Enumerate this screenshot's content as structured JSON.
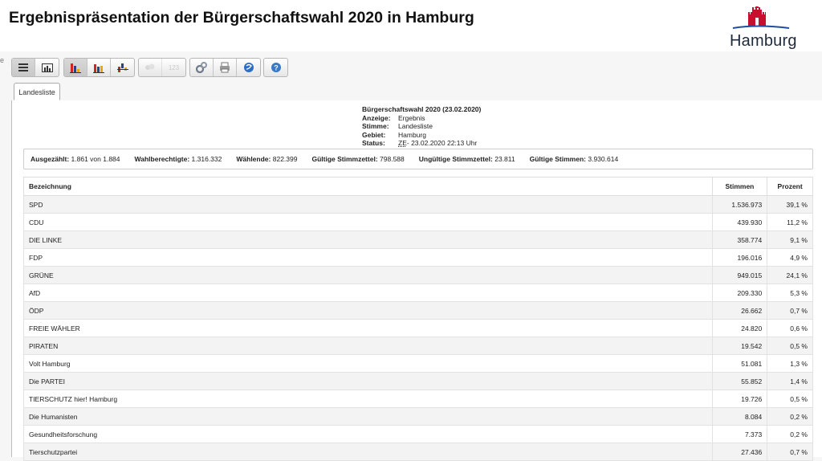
{
  "page": {
    "title": "Ergebnispräsentation der Bürgerschaftswahl 2020 in Hamburg",
    "logo_text": "Hamburg",
    "side_mark": "e"
  },
  "toolbar": {
    "buttons": [
      {
        "name": "table-view-button",
        "icon": "table-icon",
        "active": true
      },
      {
        "name": "chart-view-button",
        "icon": "chart-icon",
        "active": false
      },
      {
        "name": "bar-chart-button",
        "icon": "bar-chart-icon",
        "active": true
      },
      {
        "name": "stacked-chart-button",
        "icon": "stacked-bar-icon",
        "active": false
      },
      {
        "name": "comparison-chart-button",
        "icon": "comparison-chart-icon",
        "active": false
      },
      {
        "name": "seats-button",
        "icon": "seats-icon",
        "disabled": true
      },
      {
        "name": "number-button",
        "label": "123",
        "disabled": true
      },
      {
        "name": "settings-button",
        "icon": "gears-icon"
      },
      {
        "name": "print-button",
        "icon": "printer-icon"
      },
      {
        "name": "share-button",
        "icon": "globe-icon"
      },
      {
        "name": "help-button",
        "icon": "help-icon"
      }
    ]
  },
  "tabs": [
    {
      "label": "Landesliste",
      "active": true
    }
  ],
  "meta": {
    "title": "Bürgerschaftswahl 2020 (23.02.2020)",
    "rows": [
      {
        "key": "Anzeige:",
        "value": "Ergebnis"
      },
      {
        "key": "Stimme:",
        "value": "Landesliste"
      },
      {
        "key": "Gebiet:",
        "value": "Hamburg"
      },
      {
        "key": "Status:",
        "value_prefix": "ZE",
        "value": " - 23.02.2020 22:13 Uhr"
      }
    ]
  },
  "stats": [
    {
      "label": "Ausgezählt:",
      "value": "1.861 von 1.884"
    },
    {
      "label": "Wahlberechtigte:",
      "value": "1.316.332"
    },
    {
      "label": "Wählende:",
      "value": "822.399"
    },
    {
      "label": "Gültige Stimmzettel:",
      "value": "798.588"
    },
    {
      "label": "Ungültige Stimmzettel:",
      "value": "23.811"
    },
    {
      "label": "Gültige Stimmen:",
      "value": "3.930.614"
    }
  ],
  "table": {
    "headers": {
      "name": "Bezeichnung",
      "votes": "Stimmen",
      "pct": "Prozent"
    },
    "rows": [
      {
        "name": "SPD",
        "votes": "1.536.973",
        "pct": "39,1 %"
      },
      {
        "name": "CDU",
        "votes": "439.930",
        "pct": "11,2 %"
      },
      {
        "name": "DIE LINKE",
        "votes": "358.774",
        "pct": "9,1 %"
      },
      {
        "name": "FDP",
        "votes": "196.016",
        "pct": "4,9 %"
      },
      {
        "name": "GRÜNE",
        "votes": "949.015",
        "pct": "24,1 %"
      },
      {
        "name": "AfD",
        "votes": "209.330",
        "pct": "5,3 %"
      },
      {
        "name": "ÖDP",
        "votes": "26.662",
        "pct": "0,7 %"
      },
      {
        "name": "FREIE WÄHLER",
        "votes": "24.820",
        "pct": "0,6 %"
      },
      {
        "name": "PIRATEN",
        "votes": "19.542",
        "pct": "0,5 %"
      },
      {
        "name": "Volt Hamburg",
        "votes": "51.081",
        "pct": "1,3 %"
      },
      {
        "name": "Die PARTEI",
        "votes": "55.852",
        "pct": "1,4 %"
      },
      {
        "name": "TIERSCHUTZ hier! Hamburg",
        "votes": "19.726",
        "pct": "0,5 %"
      },
      {
        "name": "Die Humanisten",
        "votes": "8.084",
        "pct": "0,2 %"
      },
      {
        "name": "Gesundheitsforschung",
        "votes": "7.373",
        "pct": "0,2 %"
      },
      {
        "name": "Tierschutzpartei",
        "votes": "27.436",
        "pct": "0,7 %"
      }
    ]
  }
}
